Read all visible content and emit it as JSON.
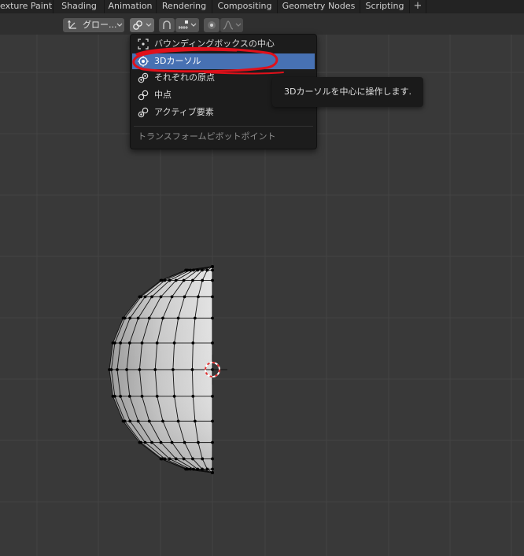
{
  "workspace_tabs": [
    "exture Paint",
    "Shading",
    "Animation",
    "Rendering",
    "Compositing",
    "Geometry Nodes",
    "Scripting",
    "+"
  ],
  "header": {
    "orientation_label": "グロー...",
    "orientation_icon": "transform-orientation-icon",
    "pivot_icon": "pivot-point-icon",
    "snap_icon": "snap-icon",
    "proportional_icon": "proportional-editing-icon",
    "falloff_icon": "falloff-curve-icon"
  },
  "pivot_menu": {
    "items": [
      {
        "label": "バウンディングボックスの中心",
        "icon": "bounding-box-center-icon",
        "selected": false
      },
      {
        "label": "3Dカーソル",
        "icon": "3d-cursor-icon",
        "selected": true
      },
      {
        "label": "それぞれの原点",
        "icon": "individual-origins-icon",
        "selected": false
      },
      {
        "label": "中点",
        "icon": "median-point-icon",
        "selected": false
      },
      {
        "label": "アクティブ要素",
        "icon": "active-element-icon",
        "selected": false
      }
    ],
    "footer": "トランスフォームピボットポイント"
  },
  "tooltip": "3Dカーソルを中心に操作します.",
  "colors": {
    "accent": "#4771b3",
    "annotation": "#e0101a",
    "background": "#393939",
    "cursor_ring": "#e03030"
  }
}
